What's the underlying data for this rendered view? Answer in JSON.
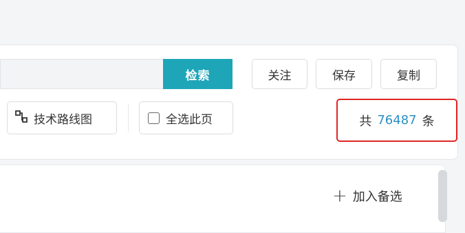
{
  "search": {
    "button_label": "检索",
    "value": ""
  },
  "toolbar": {
    "follow_label": "关注",
    "save_label": "保存",
    "copy_label": "复制"
  },
  "actions": {
    "roadmap_label": "技术路线图",
    "select_all_label": "全选此页"
  },
  "total": {
    "prefix": "共",
    "count": "76487",
    "suffix": "条"
  },
  "result": {
    "add_candidate_label": "加入备选"
  },
  "colors": {
    "search_button": "#1ea5b8",
    "count": "#2a8fc7",
    "highlight_border": "#e02424"
  },
  "icons": {
    "roadmap": "route-icon",
    "add": "plus-icon"
  }
}
